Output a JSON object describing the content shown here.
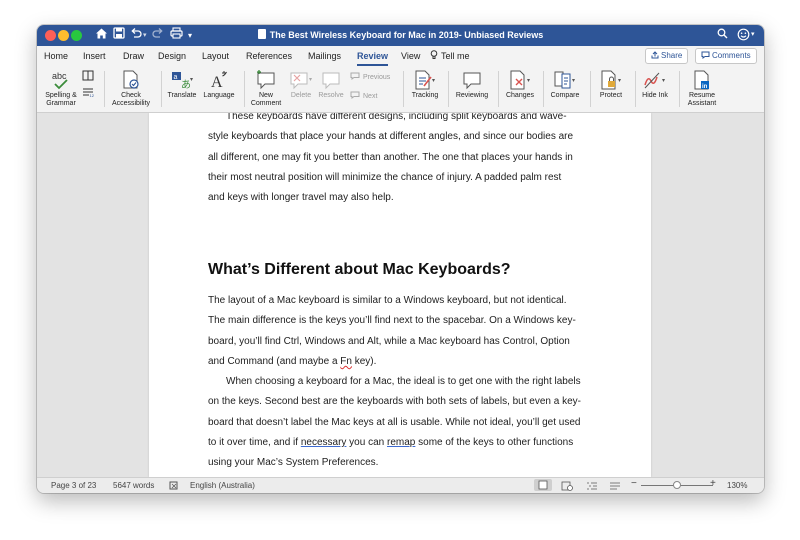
{
  "window": {
    "title": "The Best Wireless Keyboard for Mac in 2019- Unbiased Reviews"
  },
  "tabs": [
    "Home",
    "Insert",
    "Draw",
    "Design",
    "Layout",
    "References",
    "Mailings",
    "Review",
    "View"
  ],
  "tell_me": "Tell me",
  "share_label": "Share",
  "comments_label": "Comments",
  "ribbon": {
    "spelling": "Spelling &",
    "spelling2": "Grammar",
    "check": "Check",
    "check2": "Accessibility",
    "translate": "Translate",
    "language": "Language",
    "new_comment": "New",
    "new_comment2": "Comment",
    "delete": "Delete",
    "resolve": "Resolve",
    "previous": "Previous",
    "next": "Next",
    "tracking": "Tracking",
    "reviewing": "Reviewing",
    "changes": "Changes",
    "compare": "Compare",
    "protect": "Protect",
    "hide_ink": "Hide Ink",
    "resume": "Resume",
    "resume2": "Assistant"
  },
  "document": {
    "para1_lines": [
      "These keyboards have different designs, including split keyboards and wave-",
      "style keyboards that place your hands at different angles, and since our bodies are",
      "all different, one may fit you better than another. The one that places your hands in",
      "their most neutral position will minimize the chance of injury. A padded palm rest",
      "and keys with longer travel may also help."
    ],
    "heading": "What’s Different about Mac Keyboards?",
    "para2_lines": [
      "The layout of a Mac keyboard is similar to a Windows keyboard, but not identical.",
      "The main difference is the keys you’ll find next to the spacebar. On a Windows key-",
      "board, you’ll find Ctrl, Windows and Alt, while a Mac keyboard has Control, Option"
    ],
    "para2_last_a": "and Command (and maybe a ",
    "para2_last_fn": "Fn",
    "para2_last_b": " key).",
    "para3_lines": [
      "When choosing a keyboard for a Mac, the ideal is to get one with the right labels",
      "on the keys. Second best are the keyboards with both sets of labels, but even a key-",
      "board that doesn’t label the Mac keys at all is usable. While not ideal, you’ll get used"
    ],
    "para3_l4_a": "to it over time, and if ",
    "para3_l4_necessary": "necessary",
    "para3_l4_b": " you can ",
    "para3_l4_remap": "remap",
    "para3_l4_c": " some of the keys to other functions",
    "para3_last": "using your Mac’s System Preferences."
  },
  "status": {
    "page": "Page 3 of 23",
    "words": "5647 words",
    "language": "English (Australia)",
    "zoom": "130%",
    "zoom_minus": "−",
    "zoom_plus": "+"
  },
  "colors": {
    "titlebar": "#2e5597",
    "accent": "#2e5597"
  }
}
